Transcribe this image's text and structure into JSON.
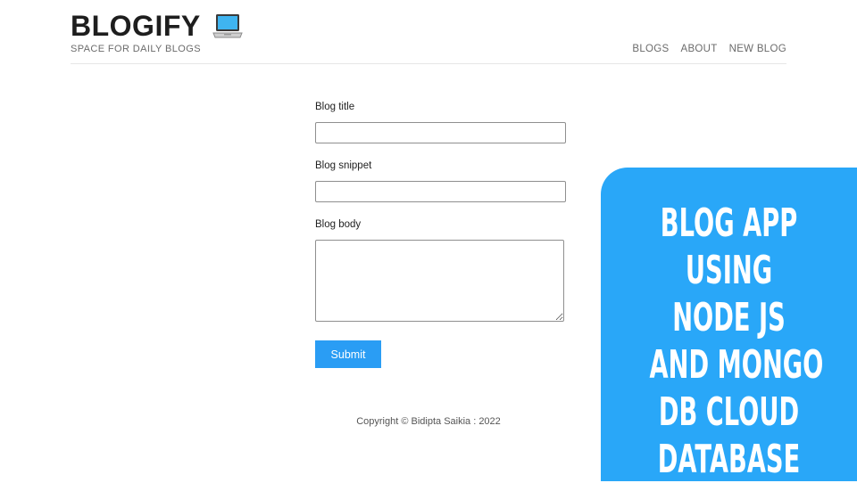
{
  "header": {
    "brand_title": "BLOGIFY",
    "brand_icon": "laptop-icon",
    "tagline": "SPACE FOR DAILY BLOGS",
    "nav": [
      {
        "label": "BLOGS"
      },
      {
        "label": "ABOUT"
      },
      {
        "label": "NEW BLOG"
      }
    ]
  },
  "form": {
    "title_label": "Blog title",
    "title_value": "",
    "snippet_label": "Blog snippet",
    "snippet_value": "",
    "body_label": "Blog body",
    "body_value": "",
    "submit_label": "Submit"
  },
  "footer": {
    "copyright": "Copyright © Bidipta Saikia : 2022"
  },
  "promo": {
    "lines": [
      "BLOG APP",
      "USING",
      "NODE JS",
      "AND MONGO",
      "DB CLOUD",
      "DATABASE"
    ]
  },
  "colors": {
    "accent": "#2a9df4",
    "promo_background": "#29a7f8",
    "text": "#222222",
    "muted_text": "#6b6b6b"
  }
}
